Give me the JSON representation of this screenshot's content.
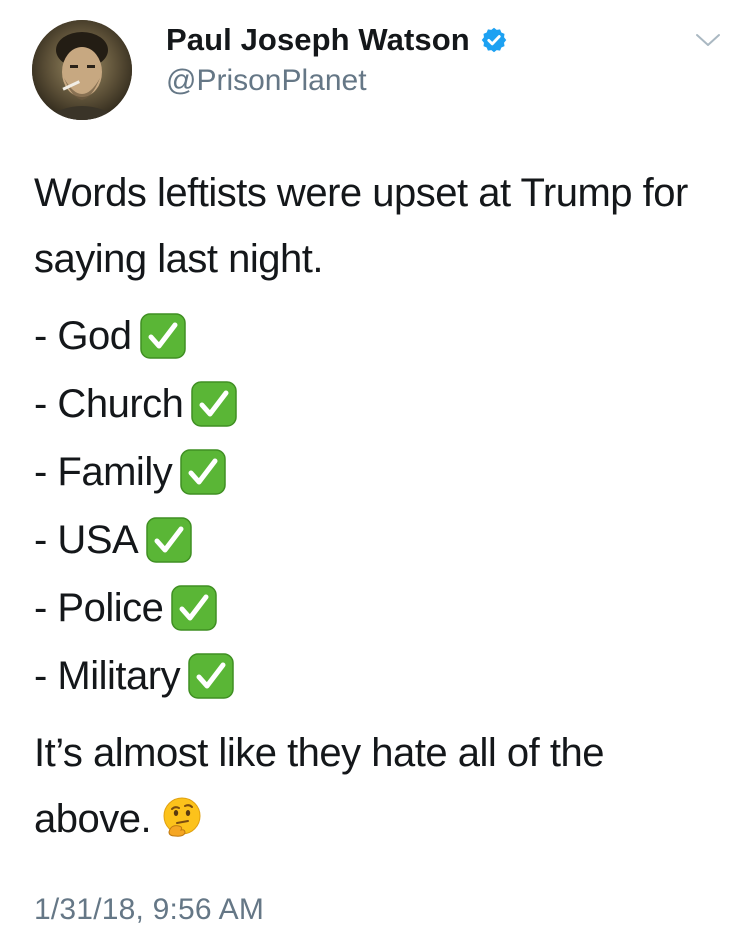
{
  "author": {
    "display_name": "Paul Joseph Watson",
    "handle": "@PrisonPlanet",
    "verified": true
  },
  "tweet": {
    "intro": "Words leftists were upset at Trump for saying last night.",
    "items": [
      {
        "label": "- God",
        "icon": "white-check-mark-icon"
      },
      {
        "label": "- Church",
        "icon": "white-check-mark-icon"
      },
      {
        "label": "- Family",
        "icon": "white-check-mark-icon"
      },
      {
        "label": "- USA",
        "icon": "white-check-mark-icon"
      },
      {
        "label": "- Police",
        "icon": "white-check-mark-icon"
      },
      {
        "label": "- Military",
        "icon": "white-check-mark-icon"
      }
    ],
    "closing": "It’s almost like they hate all of the above.",
    "closing_emoji": "thinking-face-icon",
    "timestamp": "1/31/18, 9:56 AM"
  },
  "colors": {
    "text": "#14171a",
    "secondary": "#657786",
    "verified_blue": "#1da1f2",
    "check_green": "#5ab636"
  }
}
